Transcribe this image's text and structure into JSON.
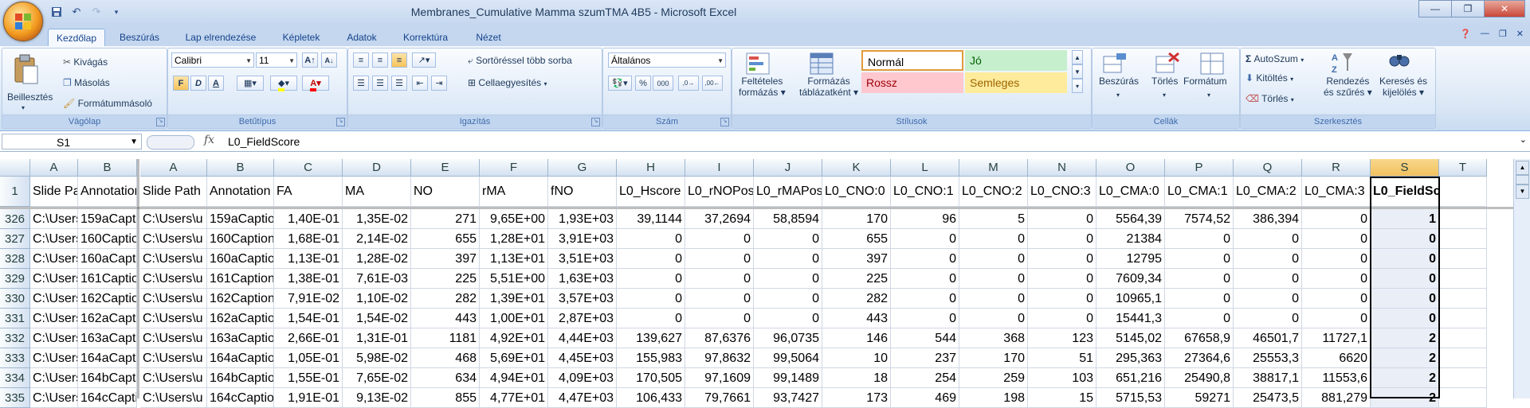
{
  "window": {
    "title": "Membranes_Cumulative Mamma szumTMA 4B5 - Microsoft Excel"
  },
  "qat_icons": [
    "save-icon",
    "undo-icon",
    "redo-icon",
    "customize-icon"
  ],
  "tabs": [
    "Kezdőlap",
    "Beszúrás",
    "Lap elrendezése",
    "Képletek",
    "Adatok",
    "Korrektúra",
    "Nézet"
  ],
  "ribbon": {
    "clipboard": {
      "label": "Vágólap",
      "paste": "Beillesztés",
      "cut": "Kivágás",
      "copy": "Másolás",
      "format_painter": "Formátummásoló"
    },
    "font": {
      "label": "Betűtípus",
      "name": "Calibri",
      "size": "11"
    },
    "alignment": {
      "label": "Igazítás",
      "wrap": "Sortöréssel több sorba",
      "merge": "Cellaegyesítés"
    },
    "number": {
      "label": "Szám",
      "format": "Általános"
    },
    "styles": {
      "label": "Stílusok",
      "conditional": "Feltételes",
      "conditional2": "formázás",
      "table": "Formázás",
      "table2": "táblázatként",
      "normal": "Normál",
      "good": "Jó",
      "bad": "Rossz",
      "neutral": "Semleges",
      "colors": {
        "good_bg": "#c6efce",
        "good_fg": "#006100",
        "bad_bg": "#ffc7ce",
        "bad_fg": "#9c0006",
        "neutral_bg": "#ffeb9c",
        "neutral_fg": "#9c6500"
      }
    },
    "cells": {
      "label": "Cellák",
      "insert": "Beszúrás",
      "delete": "Törlés",
      "format": "Formátum"
    },
    "editing": {
      "label": "Szerkesztés",
      "autosum": "AutoSzum",
      "fill": "Kitöltés",
      "clear": "Törlés",
      "sort": "Rendezés",
      "sort2": "és szűrés",
      "find": "Keresés és",
      "find2": "kijelölés"
    }
  },
  "formula_bar": {
    "name_box": "S1",
    "fx": "fx",
    "formula": "L0_FieldScore"
  },
  "sheet": {
    "frozen_columns": [
      "A",
      "B"
    ],
    "columns": [
      "A",
      "B",
      "C",
      "D",
      "E",
      "F",
      "G",
      "H",
      "I",
      "J",
      "K",
      "L",
      "M",
      "N",
      "O",
      "P",
      "Q",
      "R",
      "S",
      "T"
    ],
    "selected_column": "S",
    "header_row": {
      "row": "1",
      "frozen": [
        "Slide Path",
        "Annotation"
      ],
      "cells": [
        "Slide Path",
        "Annotation",
        "FA",
        "MA",
        "NO",
        "rMA",
        "fNO",
        "L0_Hscore",
        "L0_rNOPos",
        "L0_rMAPos",
        "L0_CNO:0",
        "L0_CNO:1",
        "L0_CNO:2",
        "L0_CNO:3",
        "L0_CMA:0",
        "L0_CMA:1",
        "L0_CMA:2",
        "L0_CMA:3",
        "L0_FieldScore",
        ""
      ]
    },
    "rows": [
      {
        "n": "326",
        "frozen": [
          "C:\\Users\\u",
          "159aCaption"
        ],
        "cells": [
          "C:\\Users\\u",
          "159aCaption",
          "1,40E-01",
          "1,35E-02",
          "271",
          "9,65E+00",
          "1,93E+03",
          "39,1144",
          "37,2694",
          "58,8594",
          "170",
          "96",
          "5",
          "0",
          "5564,39",
          "7574,52",
          "386,394",
          "0",
          "1",
          ""
        ]
      },
      {
        "n": "327",
        "frozen": [
          "C:\\Users\\u",
          "160Caption"
        ],
        "cells": [
          "C:\\Users\\u",
          "160Caption",
          "1,68E-01",
          "2,14E-02",
          "655",
          "1,28E+01",
          "3,91E+03",
          "0",
          "0",
          "0",
          "655",
          "0",
          "0",
          "0",
          "21384",
          "0",
          "0",
          "0",
          "0",
          ""
        ]
      },
      {
        "n": "328",
        "frozen": [
          "C:\\Users\\u",
          "160aCaption"
        ],
        "cells": [
          "C:\\Users\\u",
          "160aCaption",
          "1,13E-01",
          "1,28E-02",
          "397",
          "1,13E+01",
          "3,51E+03",
          "0",
          "0",
          "0",
          "397",
          "0",
          "0",
          "0",
          "12795",
          "0",
          "0",
          "0",
          "0",
          ""
        ]
      },
      {
        "n": "329",
        "frozen": [
          "C:\\Users\\u",
          "161Caption"
        ],
        "cells": [
          "C:\\Users\\u",
          "161Caption",
          "1,38E-01",
          "7,61E-03",
          "225",
          "5,51E+00",
          "1,63E+03",
          "0",
          "0",
          "0",
          "225",
          "0",
          "0",
          "0",
          "7609,34",
          "0",
          "0",
          "0",
          "0",
          ""
        ]
      },
      {
        "n": "330",
        "frozen": [
          "C:\\Users\\u",
          "162Caption"
        ],
        "cells": [
          "C:\\Users\\u",
          "162Caption",
          "7,91E-02",
          "1,10E-02",
          "282",
          "1,39E+01",
          "3,57E+03",
          "0",
          "0",
          "0",
          "282",
          "0",
          "0",
          "0",
          "10965,1",
          "0",
          "0",
          "0",
          "0",
          ""
        ]
      },
      {
        "n": "331",
        "frozen": [
          "C:\\Users\\u",
          "162aCaption"
        ],
        "cells": [
          "C:\\Users\\u",
          "162aCaption",
          "1,54E-01",
          "1,54E-02",
          "443",
          "1,00E+01",
          "2,87E+03",
          "0",
          "0",
          "0",
          "443",
          "0",
          "0",
          "0",
          "15441,3",
          "0",
          "0",
          "0",
          "0",
          ""
        ]
      },
      {
        "n": "332",
        "frozen": [
          "C:\\Users\\u",
          "163aCaption"
        ],
        "cells": [
          "C:\\Users\\u",
          "163aCaption",
          "2,66E-01",
          "1,31E-01",
          "1181",
          "4,92E+01",
          "4,44E+03",
          "139,627",
          "87,6376",
          "96,0735",
          "146",
          "544",
          "368",
          "123",
          "5145,02",
          "67658,9",
          "46501,7",
          "11727,1",
          "2",
          ""
        ]
      },
      {
        "n": "333",
        "frozen": [
          "C:\\Users\\u",
          "164aCaption"
        ],
        "cells": [
          "C:\\Users\\u",
          "164aCaption",
          "1,05E-01",
          "5,98E-02",
          "468",
          "5,69E+01",
          "4,45E+03",
          "155,983",
          "97,8632",
          "99,5064",
          "10",
          "237",
          "170",
          "51",
          "295,363",
          "27364,6",
          "25553,3",
          "6620",
          "2",
          ""
        ]
      },
      {
        "n": "334",
        "frozen": [
          "C:\\Users\\u",
          "164bCaption"
        ],
        "cells": [
          "C:\\Users\\u",
          "164bCaption",
          "1,55E-01",
          "7,65E-02",
          "634",
          "4,94E+01",
          "4,09E+03",
          "170,505",
          "97,1609",
          "99,1489",
          "18",
          "254",
          "259",
          "103",
          "651,216",
          "25490,8",
          "38817,1",
          "11553,6",
          "2",
          ""
        ]
      },
      {
        "n": "335",
        "frozen": [
          "C:\\Users\\u",
          "164cCaption"
        ],
        "cells": [
          "C:\\Users\\u",
          "164cCaption",
          "1,91E-01",
          "9,13E-02",
          "855",
          "4,77E+01",
          "4,47E+03",
          "106,433",
          "79,7661",
          "93,7427",
          "173",
          "469",
          "198",
          "15",
          "5715,53",
          "59271",
          "25473,5",
          "881,279",
          "2",
          ""
        ]
      }
    ]
  }
}
